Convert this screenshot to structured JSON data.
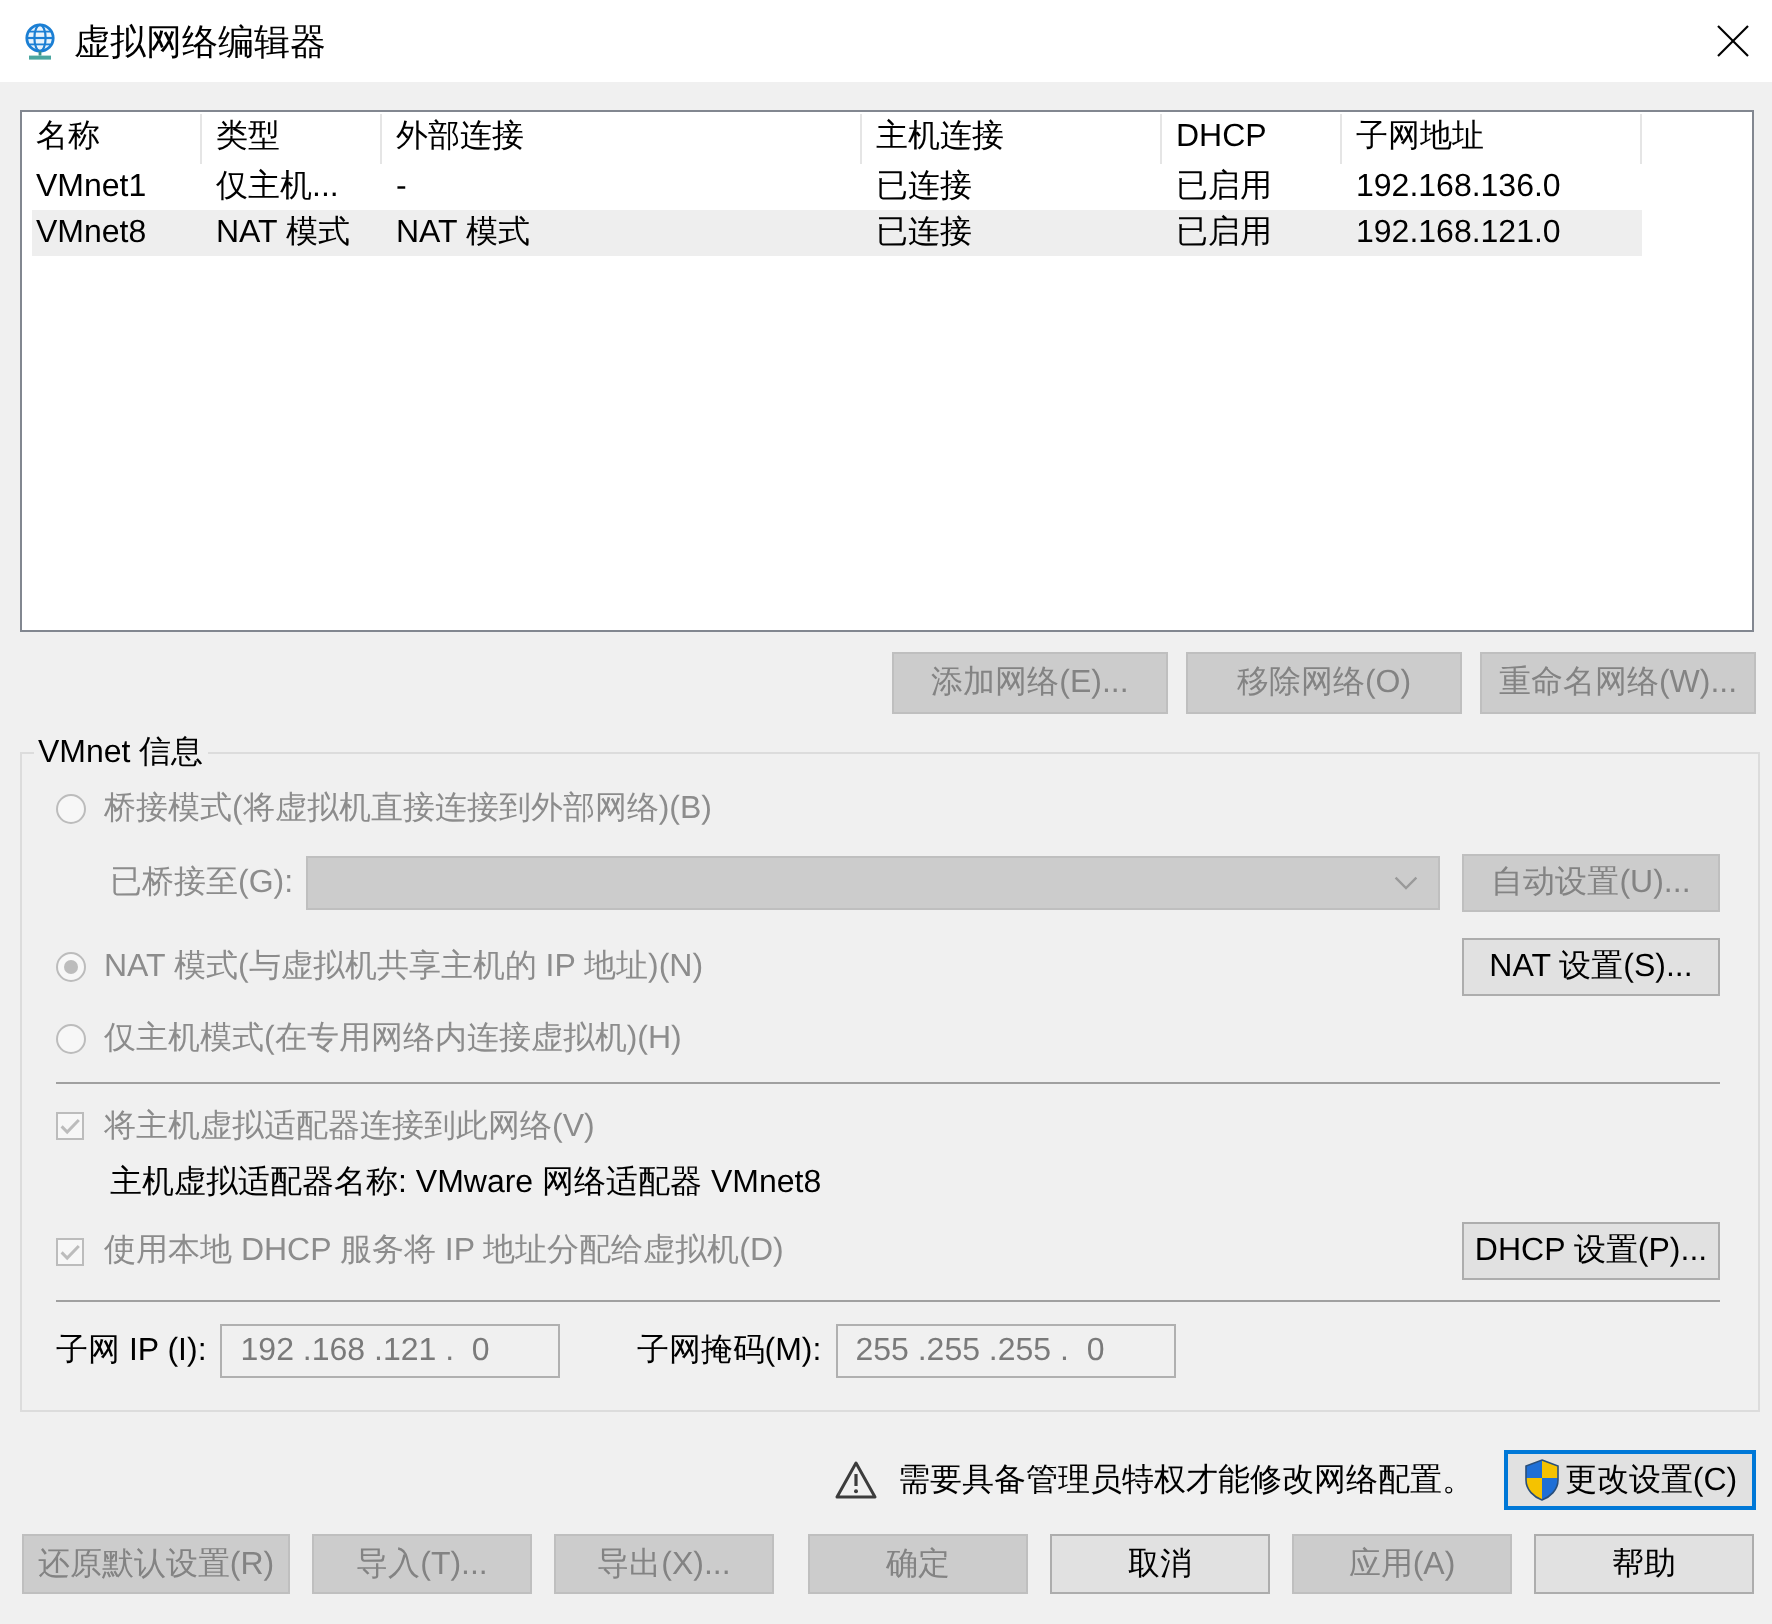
{
  "window": {
    "title": "虚拟网络编辑器"
  },
  "network_list": {
    "columns": [
      "名称",
      "类型",
      "外部连接",
      "主机连接",
      "DHCP",
      "子网地址"
    ],
    "rows": [
      {
        "cells": [
          "VMnet1",
          "仅主机...",
          "-",
          "已连接",
          "已启用",
          "192.168.136.0"
        ],
        "selected": false
      },
      {
        "cells": [
          "VMnet8",
          "NAT 模式",
          "NAT 模式",
          "已连接",
          "已启用",
          "192.168.121.0"
        ],
        "selected": true
      }
    ]
  },
  "network_buttons": [
    {
      "label": "添加网络(E)...",
      "disabled": true
    },
    {
      "label": "移除网络(O)",
      "disabled": true
    },
    {
      "label": "重命名网络(W)...",
      "disabled": true
    }
  ],
  "vmnet_info": {
    "legend": "VMnet 信息",
    "modes": [
      {
        "kind": "bridged",
        "label": "桥接模式(将虚拟机直接连接到外部网络)(B)",
        "selected": false,
        "disabled": true
      },
      {
        "kind": "nat",
        "label": "NAT 模式(与虚拟机共享主机的 IP 地址)(N)",
        "selected": true,
        "disabled": true
      },
      {
        "kind": "host_only",
        "label": "仅主机模式(在专用网络内连接虚拟机)(H)",
        "selected": false,
        "disabled": true
      }
    ],
    "bridged_to": {
      "label": "已桥接至(G):",
      "disabled": true
    },
    "auto_button": {
      "label": "自动设置(U)...",
      "disabled": true
    },
    "nat_button": {
      "label": "NAT 设置(S)...",
      "disabled": false
    },
    "connect_adapter": {
      "label": "将主机虚拟适配器连接到此网络(V)",
      "checked": true,
      "disabled": true
    },
    "adapter_name": "主机虚拟适配器名称: VMware 网络适配器 VMnet8",
    "use_dhcp": {
      "label": "使用本地 DHCP 服务将 IP 地址分配给虚拟机(D)",
      "checked": true,
      "disabled": true
    },
    "dhcp_button": {
      "label": "DHCP 设置(P)...",
      "disabled": false
    },
    "subnet_ip": {
      "label": "子网 IP (I):",
      "value": "192 .168 .121 .  0",
      "disabled": true
    },
    "subnet_mask": {
      "label": "子网掩码(M):",
      "value": "255 .255 .255 .  0",
      "disabled": true
    }
  },
  "admin_notice": {
    "text": "需要具备管理员特权才能修改网络配置。",
    "button": {
      "label": "更改设置(C)",
      "disabled": false,
      "focused": true
    }
  },
  "dialog_buttons": [
    {
      "label": "还原默认设置(R)",
      "disabled": true
    },
    {
      "label": "导入(T)...",
      "disabled": true
    },
    {
      "label": "导出(X)...",
      "disabled": true
    },
    {
      "label": "确定",
      "disabled": true
    },
    {
      "label": "取消",
      "disabled": false
    },
    {
      "label": "应用(A)",
      "disabled": true
    },
    {
      "label": "帮助",
      "disabled": false
    }
  ]
}
